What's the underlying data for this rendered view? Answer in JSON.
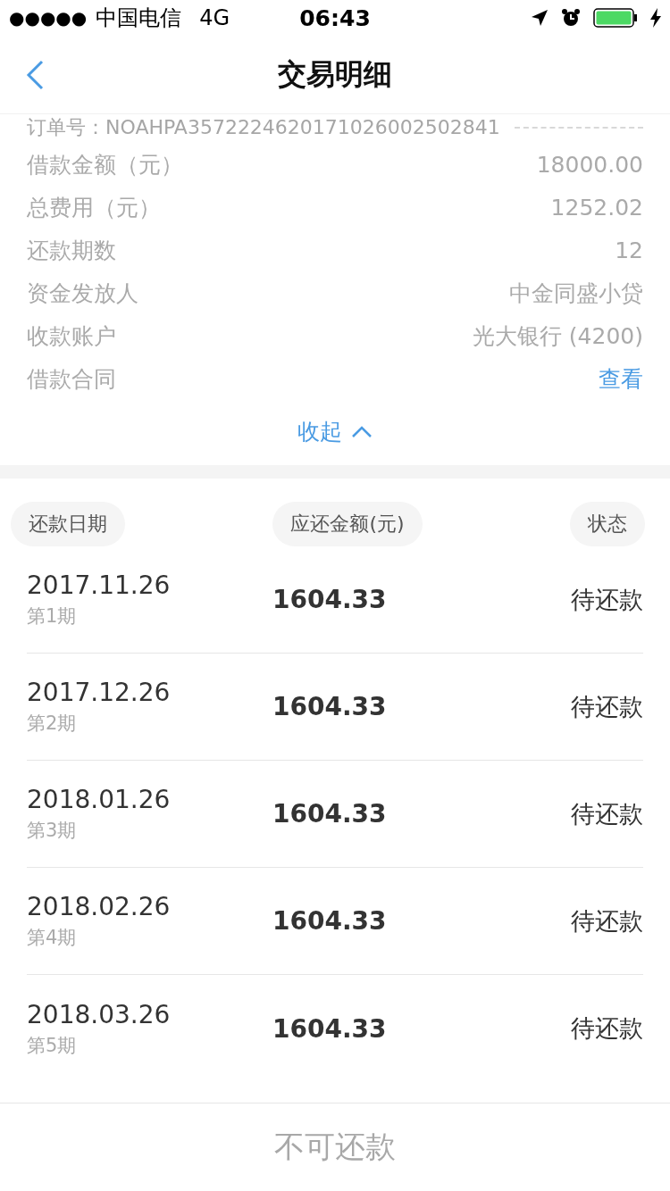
{
  "status_bar": {
    "signal": "●●●●●",
    "carrier": "中国电信",
    "network": "4G",
    "time": "06:43"
  },
  "nav": {
    "title": "交易明细"
  },
  "order": {
    "label": "订单号：",
    "value": "NOAHPA35722246201710260025028​41"
  },
  "details": [
    {
      "label": "借款金额（元）",
      "value": "18000.00",
      "kind": "text"
    },
    {
      "label": "总费用（元）",
      "value": "1252.02",
      "kind": "text"
    },
    {
      "label": "还款期数",
      "value": "12",
      "kind": "text"
    },
    {
      "label": "资金发放人",
      "value": "中金同盛小贷",
      "kind": "text"
    },
    {
      "label": "收款账户",
      "value": "光大银行 (4200)",
      "kind": "text"
    },
    {
      "label": "借款合同",
      "value": "查看",
      "kind": "link"
    }
  ],
  "collapse": {
    "label": "收起",
    "expanded": true
  },
  "table": {
    "columns": [
      "还款日期",
      "应还金额(元)",
      "状态"
    ],
    "rows": [
      {
        "date": "2017.11.26",
        "period": "第1期",
        "amount": "1604.33",
        "status": "待还款"
      },
      {
        "date": "2017.12.26",
        "period": "第2期",
        "amount": "1604.33",
        "status": "待还款"
      },
      {
        "date": "2018.01.26",
        "period": "第3期",
        "amount": "1604.33",
        "status": "待还款"
      },
      {
        "date": "2018.02.26",
        "period": "第4期",
        "amount": "1604.33",
        "status": "待还款"
      },
      {
        "date": "2018.03.26",
        "period": "第5期",
        "amount": "1604.33",
        "status": "待还款"
      }
    ]
  },
  "repay_button": {
    "label": "不可还款",
    "disabled": true
  }
}
